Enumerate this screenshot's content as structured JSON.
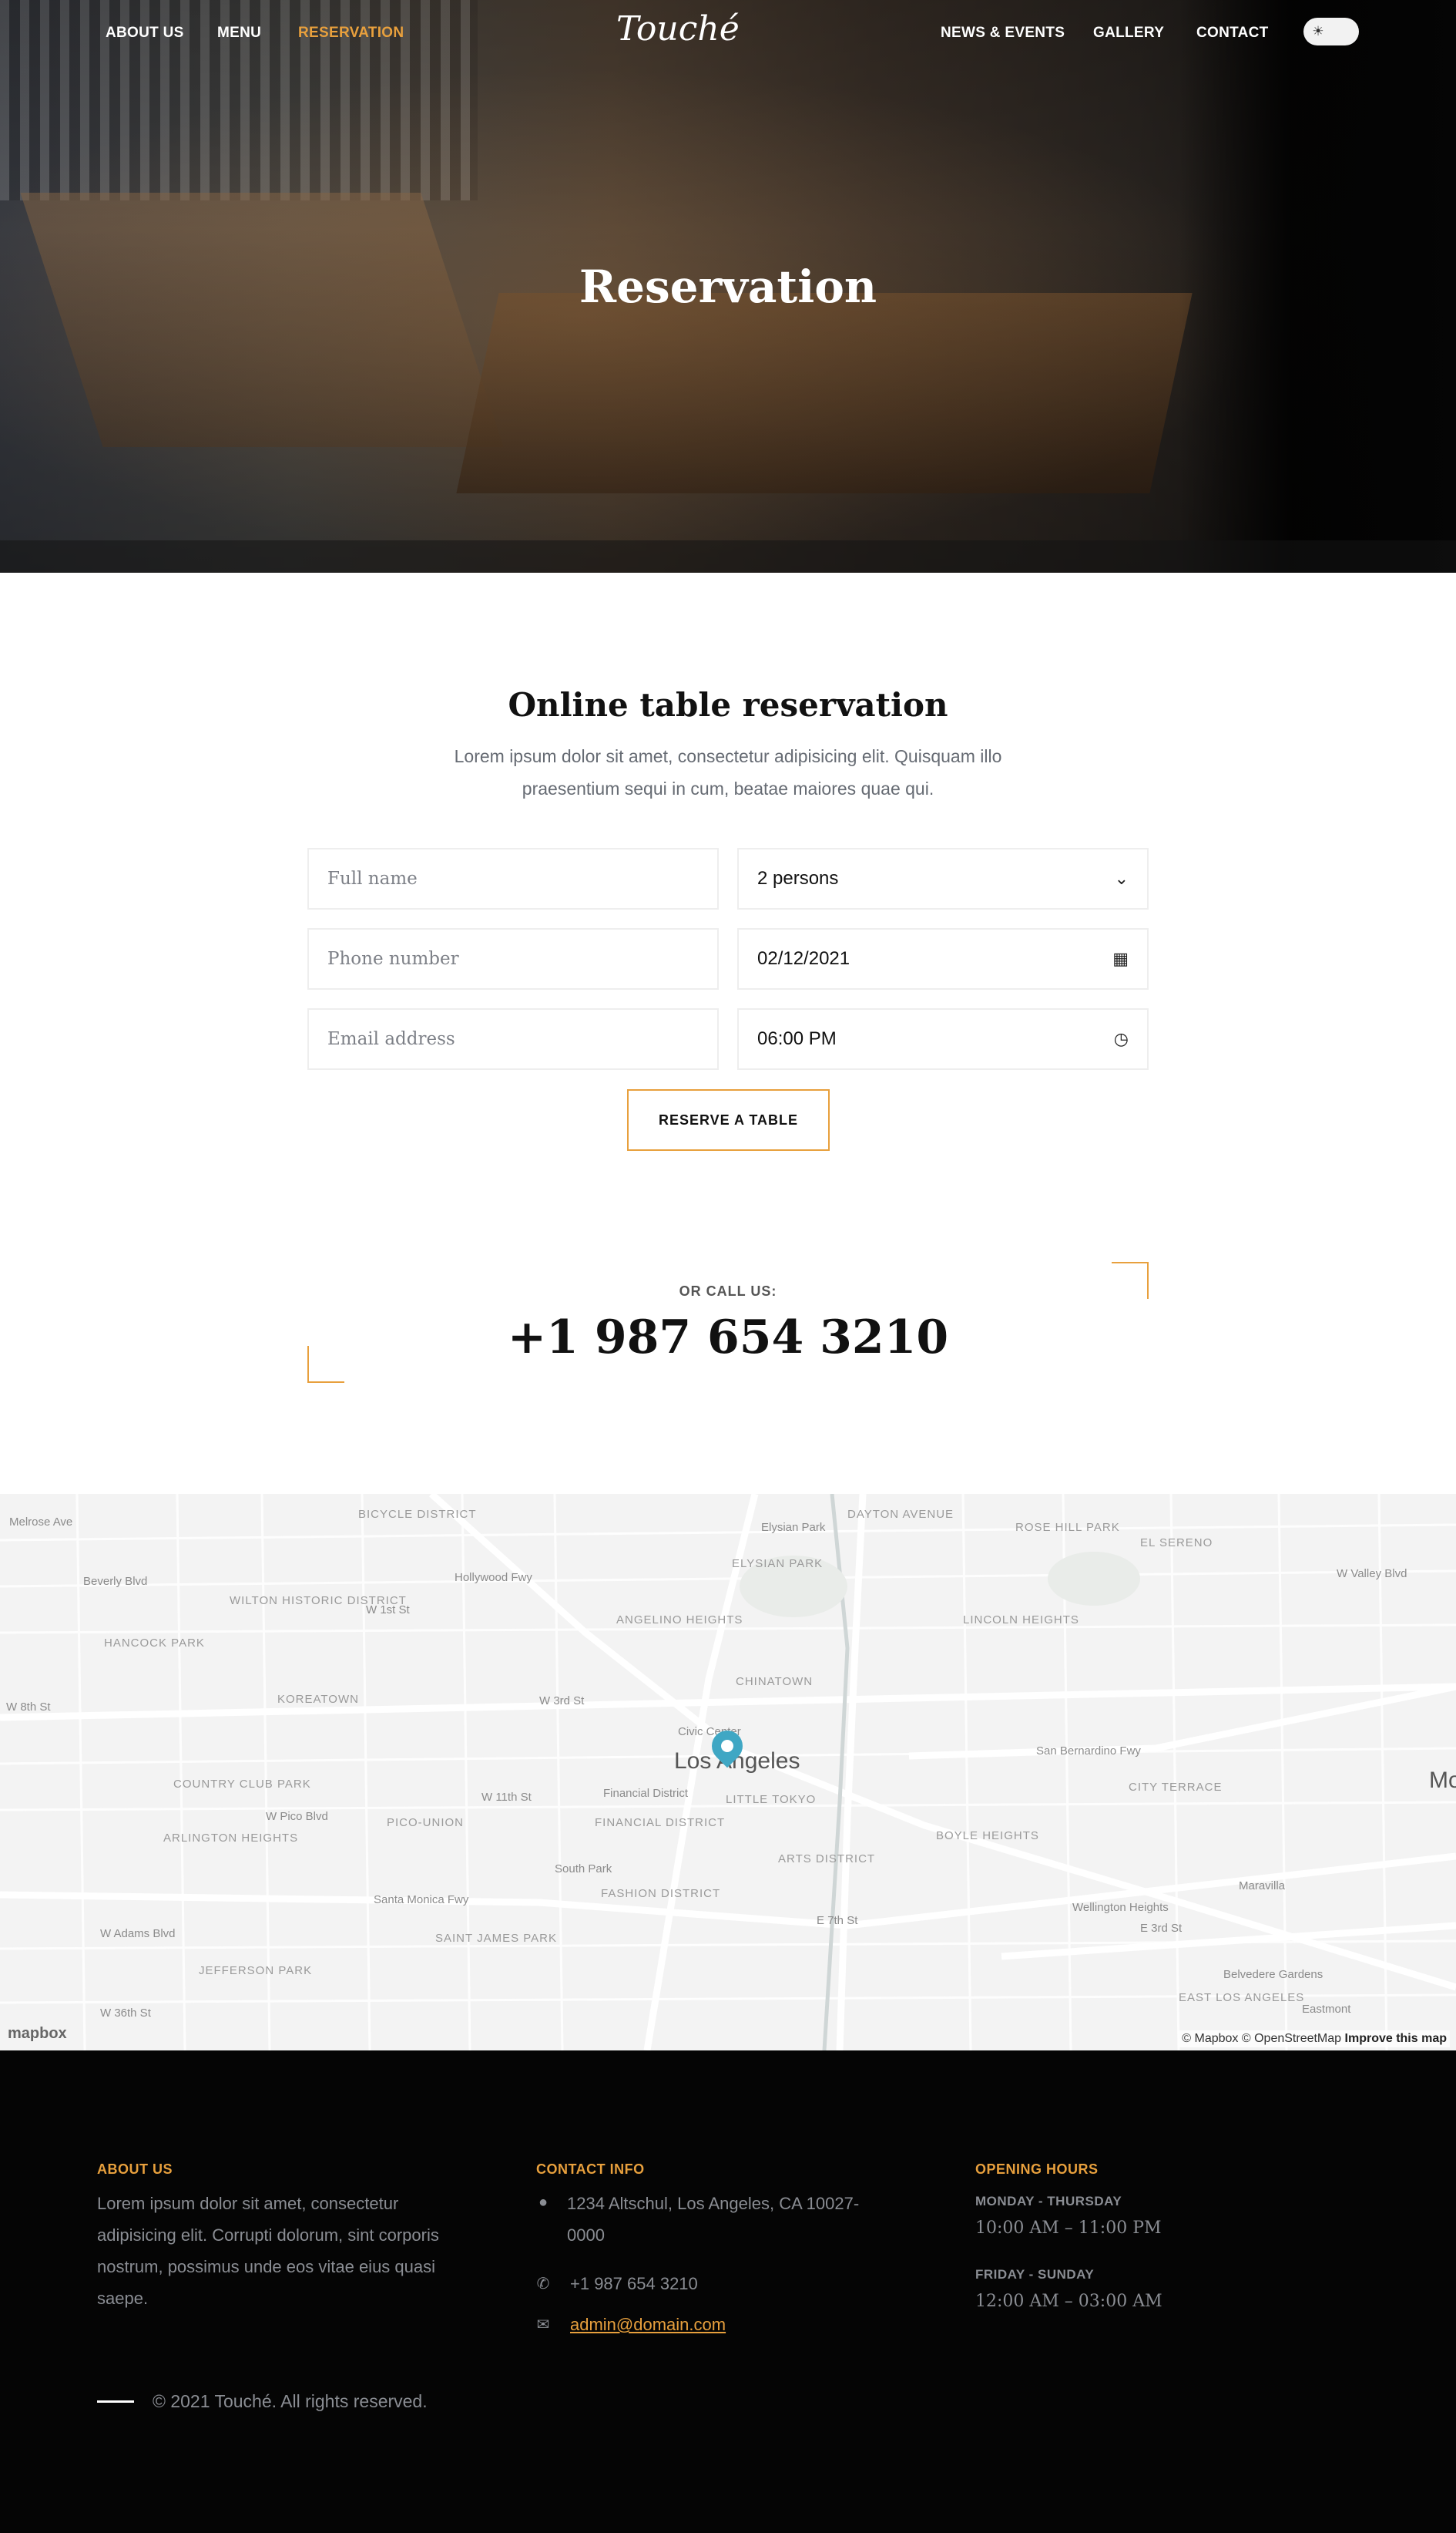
{
  "nav": {
    "items": [
      "ABOUT US",
      "MENU",
      "RESERVATION",
      "NEWS & EVENTS",
      "GALLERY",
      "CONTACT"
    ],
    "active": "RESERVATION",
    "logo": "Touché",
    "theme_toggle_icon": "sun-icon"
  },
  "hero": {
    "title": "Reservation"
  },
  "reservation": {
    "title": "Online table reservation",
    "description": "Lorem ipsum dolor sit amet, consectetur adipisicing elit. Quisquam illo praesentium sequi in cum, beatae maiores quae qui.",
    "fields": {
      "full_name_placeholder": "Full name",
      "phone_placeholder": "Phone number",
      "email_placeholder": "Email address",
      "persons_value": "2 persons",
      "date_value": "02/12/2021",
      "time_value": "06:00 PM"
    },
    "submit_label": "RESERVE A TABLE"
  },
  "call": {
    "label": "OR CALL US:",
    "phone": "+1 987 654 3210"
  },
  "map": {
    "city_label": "Los Angeles",
    "labels": [
      "Melrose Ave",
      "Beverly Blvd",
      "WILTON HISTORIC DISTRICT",
      "HANCOCK PARK",
      "W 8th St",
      "KOREATOWN",
      "W 1st St",
      "Hollywood Fwy",
      "ANGELINO HEIGHTS",
      "ELYSIAN PARK",
      "Elysian Park",
      "DAYTON AVENUE",
      "ROSE HILL PARK",
      "EL SERENO",
      "W Valley Blvd",
      "LINCOLN HEIGHTS",
      "CHINATOWN",
      "Civic Center",
      "Financial District",
      "LITTLE TOKYO",
      "W 3rd St",
      "W 11th St",
      "W Pico Blvd",
      "PICO-UNION",
      "ARLINGTON HEIGHTS",
      "COUNTRY CLUB PARK",
      "FINANCIAL DISTRICT",
      "South Park",
      "FASHION DISTRICT",
      "ARTS DISTRICT",
      "BOYLE HEIGHTS",
      "CITY TERRACE",
      "San Bernardino Fwy",
      "Santa Monica Fwy",
      "SAINT JAMES PARK",
      "W Adams Blvd",
      "JEFFERSON PARK",
      "W 36th St",
      "E 7th St",
      "E 3rd St",
      "Maravilla",
      "Wellington Heights",
      "Belvedere Gardens",
      "EAST LOS ANGELES",
      "Eastmont",
      "BICYCLE DISTRICT",
      "Mo"
    ],
    "logo": "mapbox",
    "attribution": "© Mapbox © OpenStreetMap",
    "improve": "Improve this map"
  },
  "footer": {
    "about": {
      "title": "ABOUT US",
      "text": "Lorem ipsum dolor sit amet, consectetur adipisicing elit. Corrupti dolorum, sint corporis nostrum, possimus unde eos vitae eius quasi saepe."
    },
    "contact": {
      "title": "CONTACT INFO",
      "address": "1234 Altschul, Los Angeles, CA 10027-0000",
      "phone": "+1 987 654 3210",
      "email": "admin@domain.com"
    },
    "hours": {
      "title": "OPENING HOURS",
      "weekday_label": "MONDAY - THURSDAY",
      "weekday_hours": "10:00 AM – 11:00 PM",
      "weekend_label": "FRIDAY - SUNDAY",
      "weekend_hours": "12:00 AM – 03:00 AM"
    },
    "copyright": "© 2021 Touché. All rights reserved."
  },
  "colors": {
    "accent": "#e8a03d",
    "footer_bg": "#050505",
    "pin": "#3fa7c4"
  }
}
